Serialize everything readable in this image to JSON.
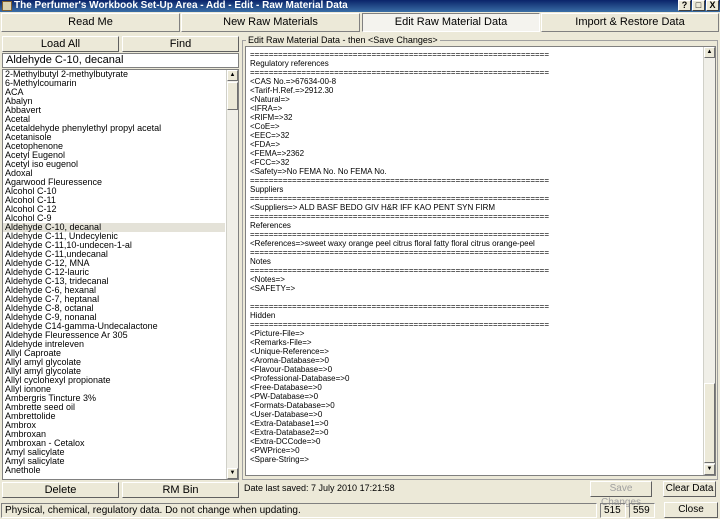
{
  "window": {
    "title": "The Perfumer's Workbook Set-Up Area  -  Add - Edit -  Raw Material Data",
    "help_btn": "?",
    "max_btn": "□",
    "close_btn": "X"
  },
  "tabs": [
    {
      "label": "Read Me",
      "active": false
    },
    {
      "label": "New Raw Materials",
      "active": false
    },
    {
      "label": "Edit Raw Material Data",
      "active": true
    },
    {
      "label": "Import & Restore Data",
      "active": false
    }
  ],
  "left": {
    "load_all": "Load All",
    "find": "Find",
    "search_value": "Aldehyde C-10, decanal",
    "items": [
      "2-Methylbutyl 2-methylbutyrate",
      "6-Methylcoumarin",
      "ACA",
      "Abalyn",
      "Abbavert",
      "Acetal",
      "Acetaldehyde phenylethyl propyl acetal",
      "Acetanisole",
      "Acetophenone",
      "Acetyl Eugenol",
      "Acetyl iso eugenol",
      "Adoxal",
      "Agarwood Fleuressence",
      "Alcohol C-10",
      "Alcohol C-11",
      "Alcohol C-12",
      "Alcohol C-9",
      "Aldehyde C-10, decanal",
      "Aldehyde C-11, Undecylenic",
      "Aldehyde C-11,10-undecen-1-al",
      "Aldehyde C-11,undecanal",
      "Aldehyde C-12, MNA",
      "Aldehyde C-12-lauric",
      "Aldehyde C-13, tridecanal",
      "Aldehyde C-6, hexanal",
      "Aldehyde C-7, heptanal",
      "Aldehyde C-8, octanal",
      "Aldehyde C-9, nonanal",
      "Aldehyde C14-gamma-Undecalactone",
      "Aldehyde Fleuressence Ar 305",
      "Aldehyde intreleven",
      "Allyl Caproate",
      "Allyl amyl glycolate",
      "Allyl amyl glycolate",
      "Allyl cyclohexyl propionate",
      "Allyl ionone",
      "Ambergris Tincture 3%",
      "Ambrette seed oil",
      "Ambrettolide",
      "Ambrox",
      "Ambroxan",
      "Ambroxan - Cetalox",
      "Amyl salicylate",
      "Amyl salicylate",
      "Anethole"
    ],
    "selected_index": 17,
    "delete": "Delete",
    "rm_bin": "RM Bin"
  },
  "right": {
    "group_label": "Edit Raw Material Data - then <Save Changes>",
    "lines": [
      "================================================================",
      "Regulatory references",
      "================================================================",
      "<CAS No.=>67634-00-8",
      "<Tarif-H.Ref.=>2912.30",
      "<Natural=>",
      "<IFRA=>",
      "<RIFM=>32",
      "<CoE=>",
      "<EEC=>32",
      "<FDA=>",
      "<FEMA=>2362",
      "<FCC=>32",
      "<Safety=>No FEMA No. No FEMA No.",
      "================================================================",
      "Suppliers",
      "================================================================",
      "<Suppliers=> ALD BASF BEDO GIV H&R IFF KAO PENT SYN FIRM",
      "================================================================",
      "References",
      "================================================================",
      "<References=>sweet waxy orange peel citrus floral fatty floral citrus orange-peel",
      "================================================================",
      "Notes",
      "================================================================",
      "<Notes=>",
      "<SAFETY=>",
      "",
      "================================================================",
      "Hidden",
      "================================================================",
      "<Picture-File=>",
      "<Remarks-File=>",
      "<Unique-Reference=>",
      "<Aroma-Database=>0",
      "<Flavour-Database=>0",
      "<Professional-Database=>0",
      "<Free-Database=>0",
      "<PW-Database=>0",
      "<Formats-Database=>0",
      "<User-Database=>0",
      "<Extra-Database1=>0",
      "<Extra-Database2=>0",
      "<Extra-DCCode=>0",
      "<PWPrice=>0",
      "<Spare-String=>"
    ],
    "date_saved": "Date last saved: 7 July 2010  17:21:58",
    "save_changes": "Save Changes",
    "clear_data": "Clear Data"
  },
  "status": {
    "message": "Physical, chemical, regulatory data. Do not change when updating.",
    "count1": "515",
    "count2": "559",
    "close": "Close"
  }
}
